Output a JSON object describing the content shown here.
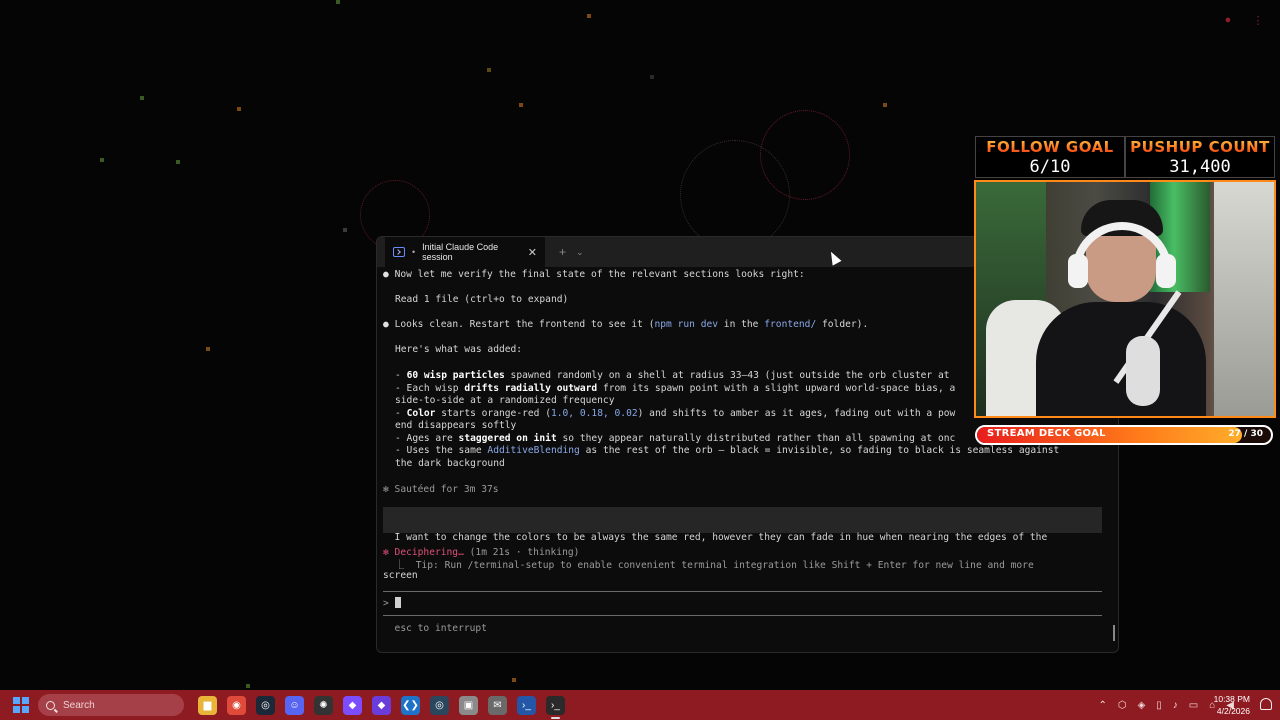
{
  "terminal": {
    "tab_title": "Initial Claude Code session",
    "tab_close": "✕",
    "new_tab": "+",
    "tab_dropdown": "⌄",
    "lines": {
      "l1": "Now let me verify the final state of the relevant sections looks right:",
      "l2": "Read 1 file (ctrl+o to expand)",
      "l3_a": "Looks clean. Restart the frontend to see it (",
      "l3_b": "npm run dev",
      "l3_c": " in the ",
      "l3_d": "frontend/",
      "l3_e": " folder).",
      "l4": "Here's what was added:",
      "b1_a": "- ",
      "b1_b": "60 wisp particles",
      "b1_c": " spawned randomly on a shell at radius 33–43 (just outside the orb cluster at",
      "b2_a": "- Each wisp ",
      "b2_b": "drifts radially outward",
      "b2_c": " from its spawn point with a slight upward world-space bias, a",
      "b2_d": "side-to-side at a randomized frequency",
      "b3_a": "- ",
      "b3_b": "Color",
      "b3_c": " starts orange-red (",
      "b3_d": "1.0, 0.18, 0.02",
      "b3_e": ") and shifts to amber as it ages, fading out with a pow",
      "b3_f": "end disappears softly",
      "b4_a": "- Ages are ",
      "b4_b": "staggered on init",
      "b4_c": " so they appear naturally distributed rather than all spawning at onc",
      "b5_a": "- Uses the same ",
      "b5_b": "AdditiveBlending",
      "b5_c": " as the rest of the orb — black = invisible, so fading to black is seamless against",
      "b5_d": "the dark background",
      "sauteed": "✻ Sautéed for 3m 37s",
      "user_msg_1": "  I want to change the colors to be always the same red, however they can fade in hue when nearing the edges of the",
      "user_msg_2": "screen",
      "status_a": "✻ Deciphering…",
      "status_b": " (1m 21s · thinking)",
      "tip": "  ⎿  Tip: Run /terminal-setup to enable convenient terminal integration like Shift + Enter for new line and more",
      "prompt": "> ",
      "footer": "  esc to interrupt"
    }
  },
  "overlay": {
    "follow_goal_title": "FOLLOW GOAL",
    "follow_goal_value": "6/10",
    "pushup_title": "PUSHUP COUNT",
    "pushup_value": "31,400",
    "stream_deck_label": "STREAM DECK GOAL",
    "stream_deck_count": "27 / 30",
    "stream_deck_progress": 0.9,
    "border_color": "#ff8a1a"
  },
  "taskbar": {
    "search_placeholder": "Search",
    "time": "10:38 PM",
    "date": "4/2/2026",
    "tray_expand": "⌃",
    "background": "#8e1a22"
  },
  "apps": [
    {
      "name": "file-explorer-icon",
      "glyph": "▆",
      "color": "#e8b53a"
    },
    {
      "name": "chrome-icon",
      "glyph": "◉",
      "color": "#e04a3a"
    },
    {
      "name": "steam-icon",
      "glyph": "◎",
      "color": "#1b2838"
    },
    {
      "name": "discord-icon",
      "glyph": "☺",
      "color": "#5865f2"
    },
    {
      "name": "openai-icon",
      "glyph": "✺",
      "color": "#333333"
    },
    {
      "name": "obsidian-icon",
      "glyph": "◆",
      "color": "#7c4dff"
    },
    {
      "name": "obsidian-icon-2",
      "glyph": "◆",
      "color": "#6a3ddb"
    },
    {
      "name": "vscode-icon",
      "glyph": "❮❯",
      "color": "#1e73c8"
    },
    {
      "name": "steam-icon-2",
      "glyph": "◎",
      "color": "#2a475e"
    },
    {
      "name": "store-icon",
      "glyph": "▣",
      "color": "#8a8a8a"
    },
    {
      "name": "mail-icon",
      "glyph": "✉",
      "color": "#6a6a6a"
    },
    {
      "name": "powershell-icon",
      "glyph": "›_",
      "color": "#2456a8"
    },
    {
      "name": "terminal-icon",
      "glyph": "›_",
      "color": "#2a2a2a"
    }
  ]
}
